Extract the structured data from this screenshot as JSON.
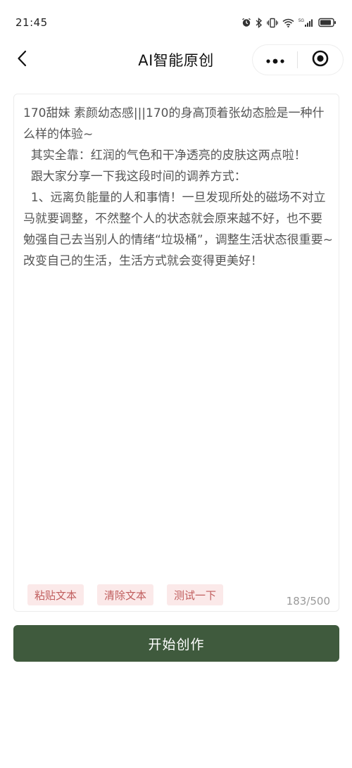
{
  "status_bar": {
    "time": "21:45",
    "icons": [
      "alarm-icon",
      "bluetooth-icon",
      "vibrate-icon",
      "wifi-icon",
      "signal-5g-icon",
      "battery-icon"
    ]
  },
  "nav": {
    "title": "AI智能原创",
    "back_icon": "chevron-left-icon",
    "more_icon": "more-dots-icon",
    "close_icon": "target-close-icon"
  },
  "editor": {
    "content": "170甜妹 素颜幼态感|||170的身高顶着张幼态脸是一种什么样的体验~\n  其实全靠：红润的气色和干净透亮的皮肤这两点啦！\n  跟大家分享一下我这段时间的调养方式：\n  1、远离负能量的人和事情！一旦发现所处的磁场不对立马就要调整，不然整个人的状态就会原来越不好，也不要勉强自己去当别人的情绪“垃圾桶”，调整生活状态很重要~改变自己的生活，生活方式就会变得更美好！",
    "char_count": "183/500",
    "actions": {
      "paste": "粘贴文本",
      "clear": "清除文本",
      "test": "测试一下"
    }
  },
  "primary_button": {
    "label": "开始创作"
  },
  "colors": {
    "primary": "#3f5a3d",
    "chip_bg": "#fbe9e9",
    "chip_text": "#c05d5d"
  }
}
